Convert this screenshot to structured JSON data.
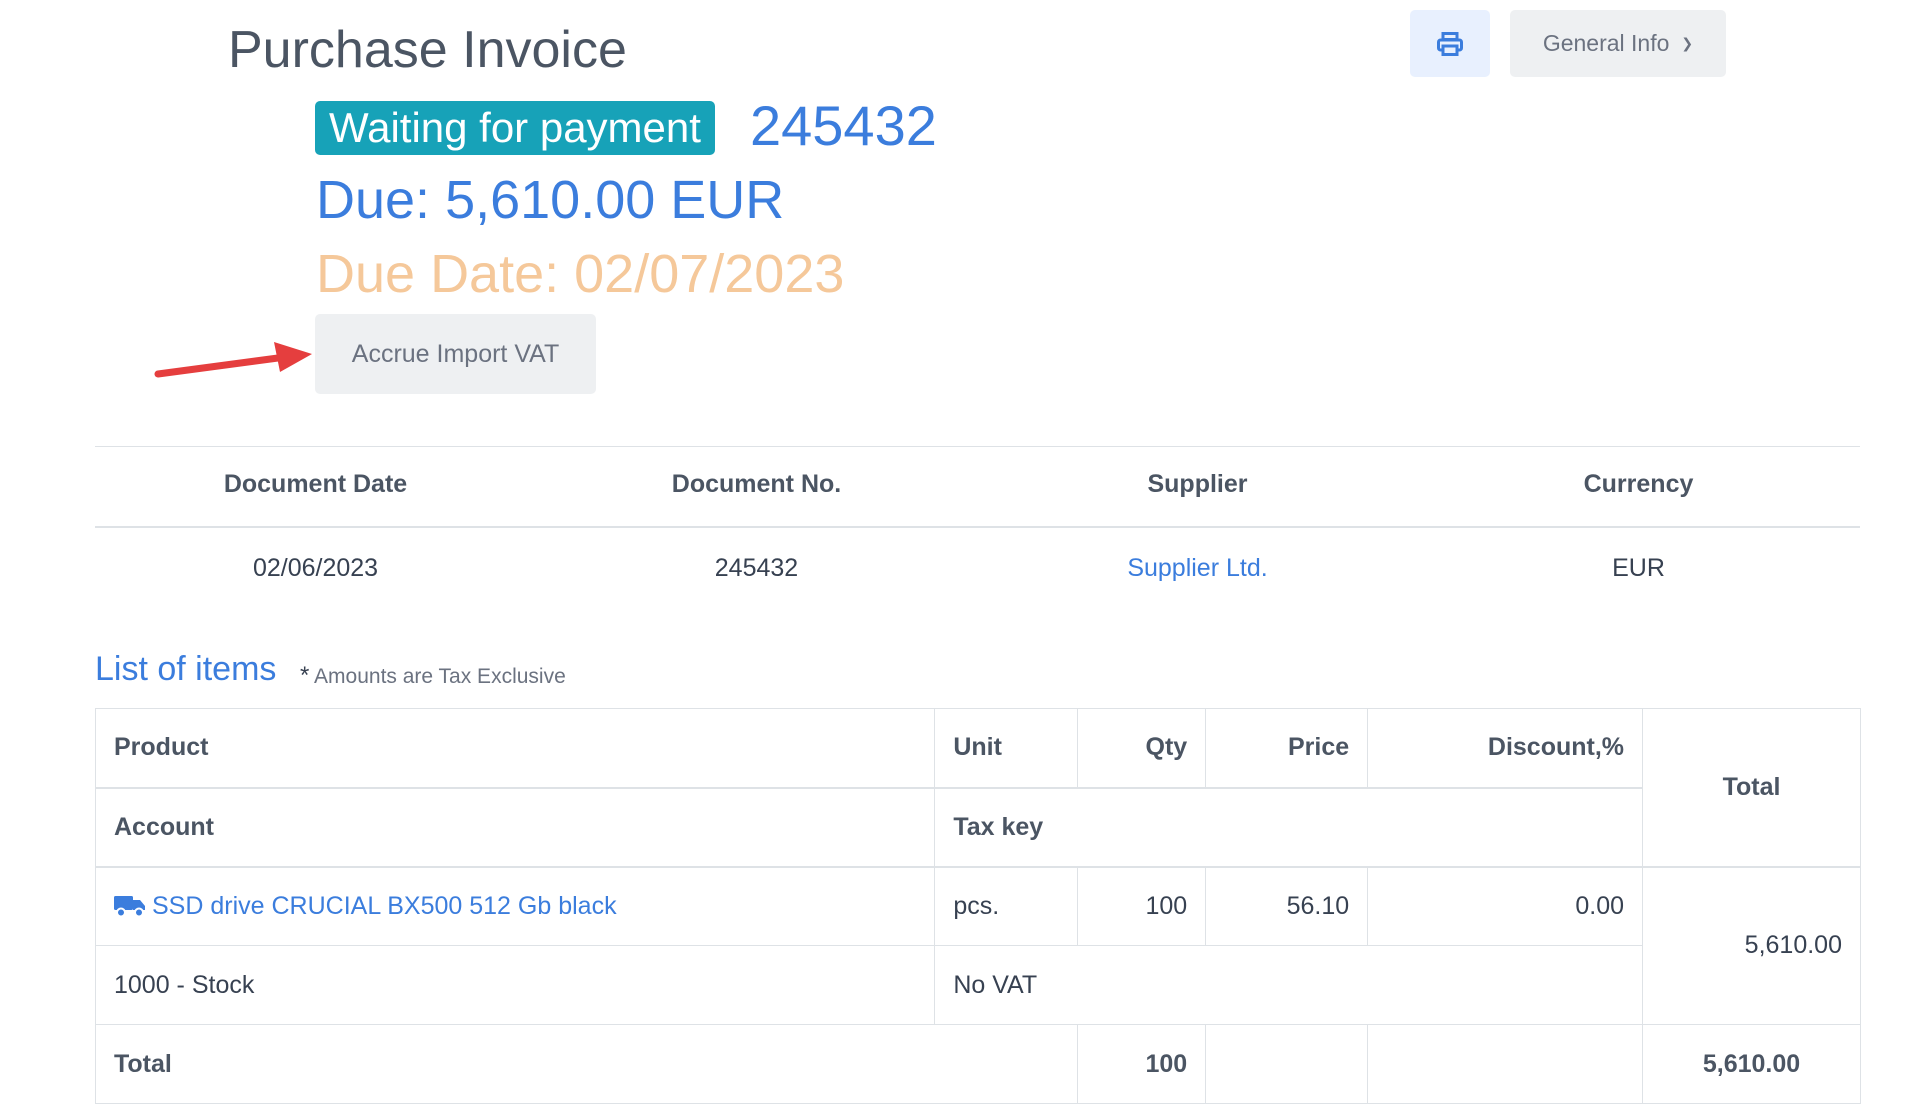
{
  "header": {
    "title": "Purchase Invoice",
    "general_info_label": "General Info",
    "print_icon": "printer-icon",
    "chevron_icon": "chevron-down-icon"
  },
  "status": {
    "badge": "Waiting for payment",
    "number": "245432",
    "due": "Due: 5,610.00 EUR",
    "due_date": "Due Date: 02/07/2023",
    "accrue_button": "Accrue Import VAT"
  },
  "colors": {
    "accent": "#3b7ddd",
    "badge": "#17a2b8",
    "due_date": "#f5c89a",
    "arrow": "#e53e3e"
  },
  "doc_info": {
    "headers": [
      "Document Date",
      "Document No.",
      "Supplier",
      "Currency"
    ],
    "values": [
      "02/06/2023",
      "245432",
      "Supplier Ltd.",
      "EUR"
    ]
  },
  "items_section": {
    "title": "List of items",
    "note_star": "*",
    "note": "Amounts are Tax Exclusive"
  },
  "items_table": {
    "headers": {
      "product": "Product",
      "unit": "Unit",
      "qty": "Qty",
      "price": "Price",
      "discount": "Discount,%",
      "total": "Total",
      "account": "Account",
      "tax_key": "Tax key"
    },
    "rows": [
      {
        "product": "SSD drive CRUCIAL BX500 512 Gb black",
        "product_icon": "truck-icon",
        "unit": "pcs.",
        "qty": "100",
        "price": "56.10",
        "discount": "0.00",
        "total": "5,610.00",
        "account": "1000 - Stock",
        "tax_key": "No VAT"
      }
    ],
    "footer": {
      "label": "Total",
      "qty": "100",
      "total": "5,610.00"
    }
  }
}
